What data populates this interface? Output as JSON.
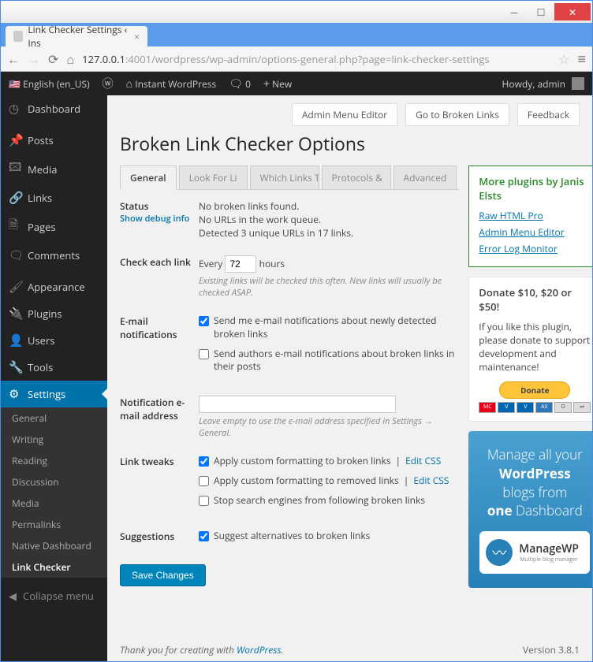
{
  "window": {
    "tab_title": "Link Checker Settings ‹ Ins",
    "url_prefix": "127.0.0.1",
    "url_rest": ":4001/wordpress/wp-admin/options-general.php?page=link-checker-settings"
  },
  "adminbar": {
    "lang": "English (en_US)",
    "site": "Instant WordPress",
    "comments": "0",
    "new": "New",
    "greeting": "Howdy, admin"
  },
  "top_actions": {
    "admin_menu_editor": "Admin Menu Editor",
    "goto_broken": "Go to Broken Links",
    "feedback": "Feedback"
  },
  "page_title": "Broken Link Checker Options",
  "tabs": {
    "general": "General",
    "look_for": "Look For Li",
    "which_links": "Which Links To",
    "protocols": "Protocols &",
    "advanced": "Advanced"
  },
  "sidebar": {
    "dashboard": "Dashboard",
    "posts": "Posts",
    "media": "Media",
    "links": "Links",
    "pages": "Pages",
    "comments": "Comments",
    "appearance": "Appearance",
    "plugins": "Plugins",
    "users": "Users",
    "tools": "Tools",
    "settings": "Settings",
    "sub_general": "General",
    "sub_writing": "Writing",
    "sub_reading": "Reading",
    "sub_discussion": "Discussion",
    "sub_media": "Media",
    "sub_permalinks": "Permalinks",
    "sub_native": "Native Dashboard",
    "sub_linkchecker": "Link Checker",
    "collapse": "Collapse menu"
  },
  "form": {
    "status_label": "Status",
    "debug_link": "Show debug info",
    "status_line1": "No broken links found.",
    "status_line2": "No URLs in the work queue.",
    "status_line3": "Detected 3 unique URLs in 17 links.",
    "check_label": "Check each link",
    "every": "Every",
    "hours": "hours",
    "interval_value": "72",
    "check_help": "Existing links will be checked this often. New links will usually be checked ASAP.",
    "email_label": "E-mail notifications",
    "email_me": "Send me e-mail notifications about newly detected broken links",
    "email_authors": "Send authors e-mail notifications about broken links in their posts",
    "notif_addr_label": "Notification e-mail address",
    "notif_help": "Leave empty to use the e-mail address specified in Settings → General.",
    "tweaks_label": "Link tweaks",
    "tweak_broken": "Apply custom formatting to broken links",
    "tweak_removed": "Apply custom formatting to removed links",
    "tweak_seo": "Stop search engines from following broken links",
    "edit_css": "Edit CSS",
    "sep": " | ",
    "suggestions_label": "Suggestions",
    "suggestions_chk": "Suggest alternatives to broken links",
    "save": "Save Changes"
  },
  "side": {
    "more_plugins_title": "More plugins by Janis Elsts",
    "plugin1": "Raw HTML Pro",
    "plugin2": "Admin Menu Editor",
    "plugin3": "Error Log Monitor",
    "donate_title": "Donate $10, $20 or $50!",
    "donate_text": "If you like this plugin, please donate to support development and maintenance!",
    "donate_btn": "Donate",
    "ad_line": "Manage all your",
    "ad_wp": "WordPress",
    "ad_blogs": "blogs from",
    "ad_one": "one",
    "ad_dash": " Dashboard",
    "ad_brand": "ManageWP",
    "ad_sub": "Multiple blog manager"
  },
  "footer": {
    "thanks_pre": "Thank you for creating with ",
    "wp": "WordPress",
    "version": "Version 3.8.1"
  }
}
